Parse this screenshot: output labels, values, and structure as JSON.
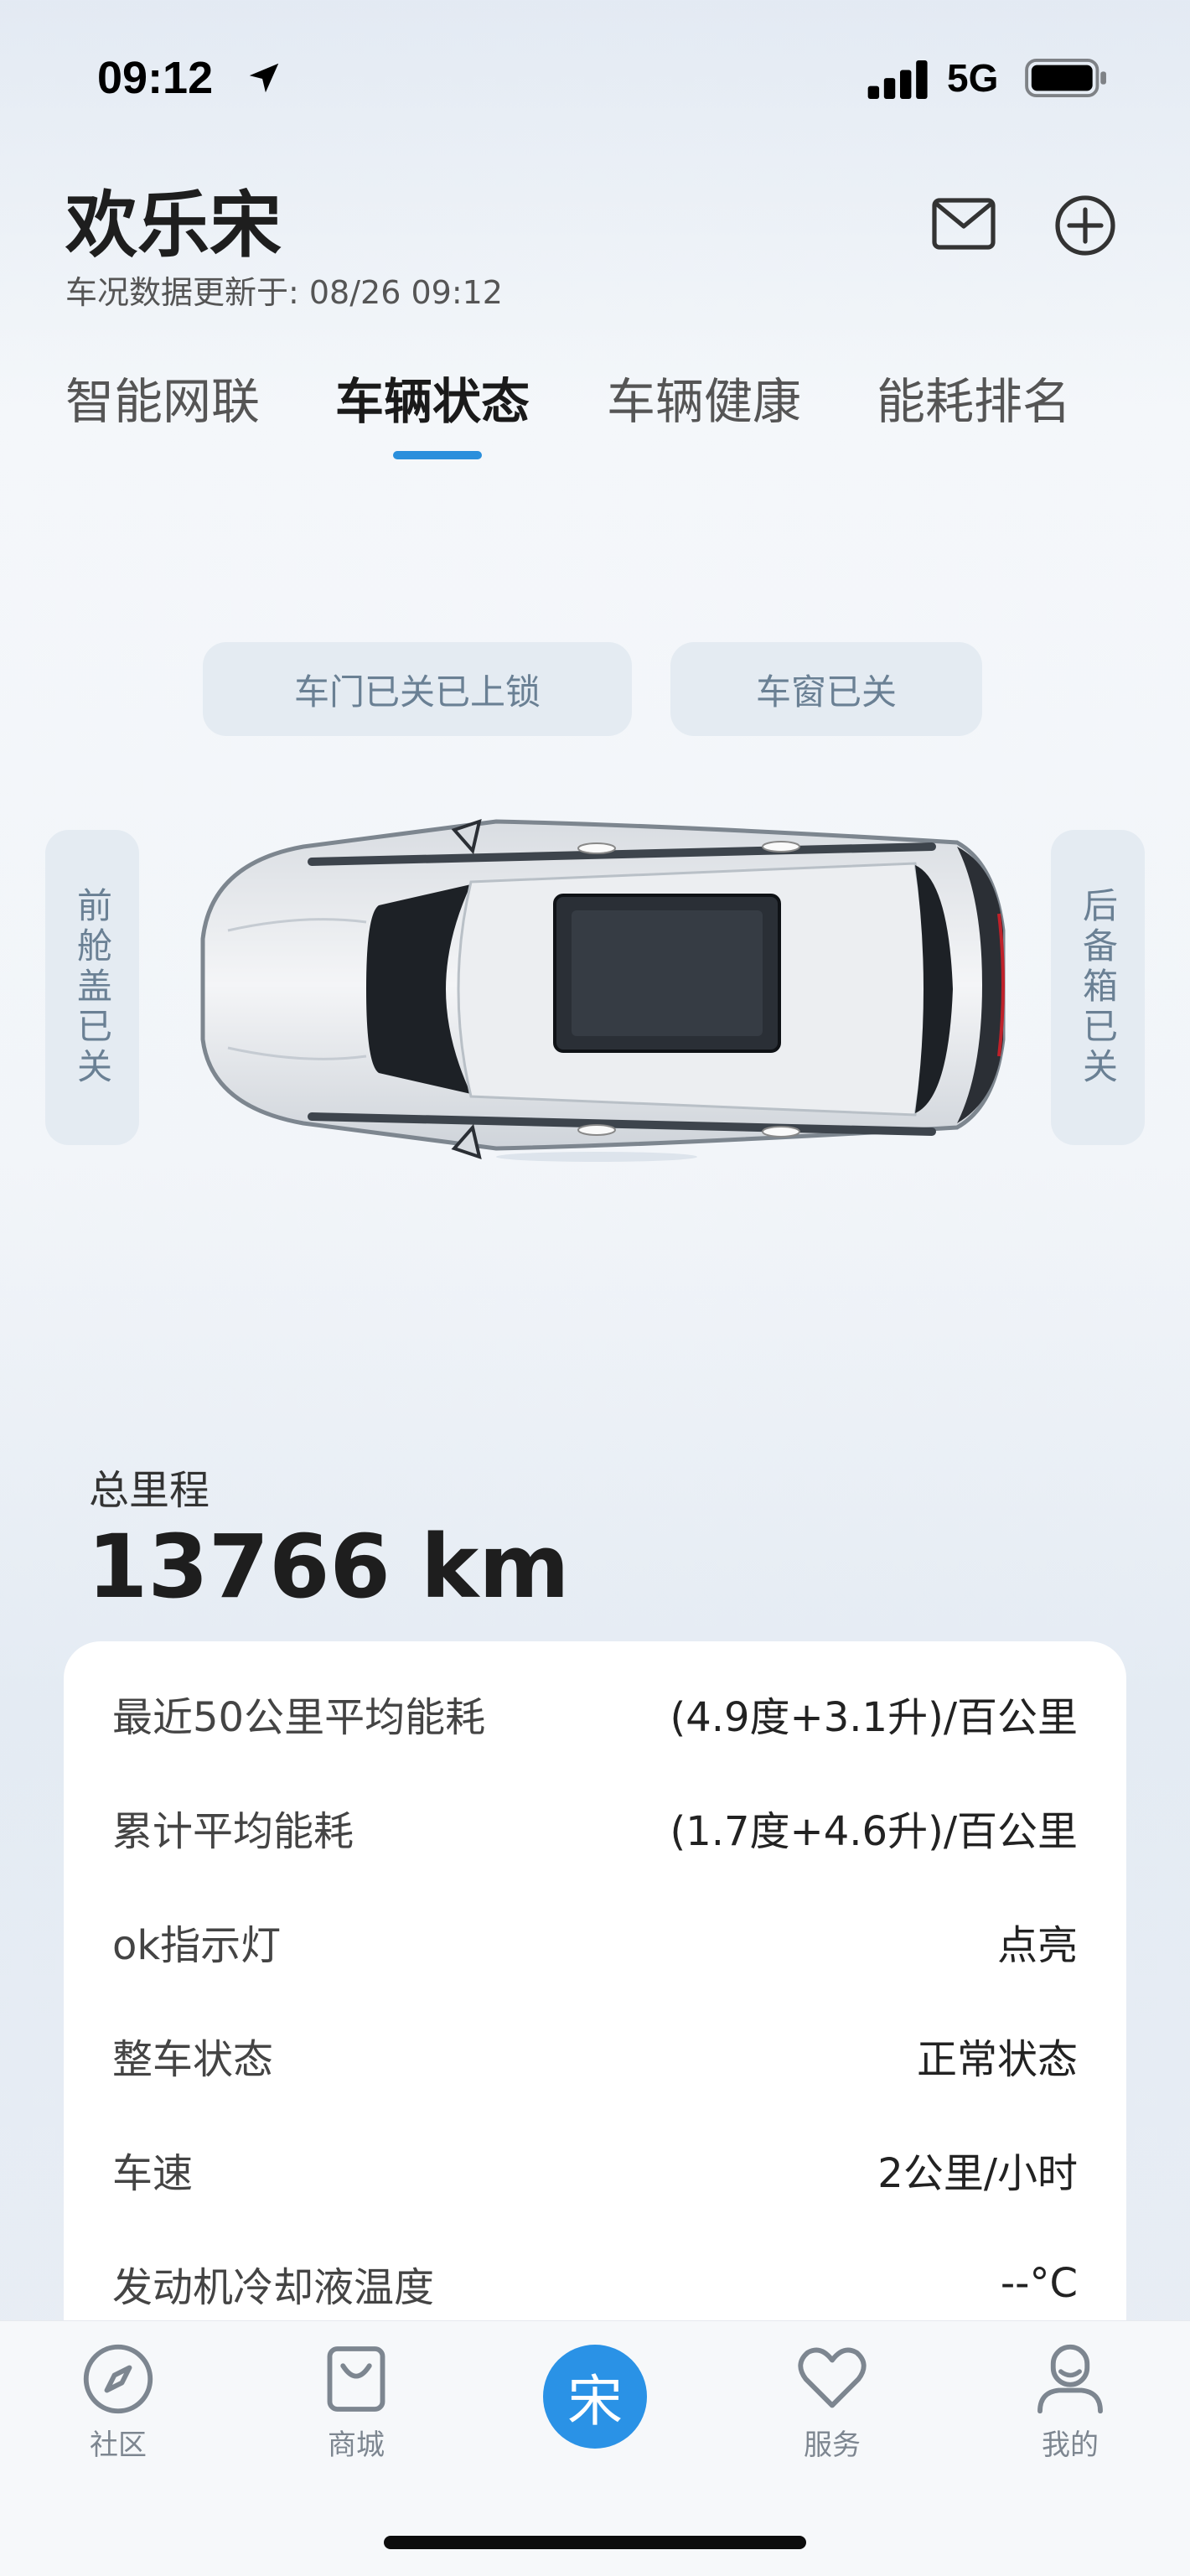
{
  "status_bar": {
    "time": "09:12",
    "network": "5G"
  },
  "header": {
    "title": "欢乐宋",
    "update_time": "车况数据更新于: 08/26 09:12"
  },
  "tabs": [
    {
      "label": "智能网联"
    },
    {
      "label": "车辆状态",
      "active": true
    },
    {
      "label": "车辆健康"
    },
    {
      "label": "能耗排名"
    }
  ],
  "vehicle": {
    "door_status": "车门已关已上锁",
    "window_status": "车窗已关",
    "hood_status": "前舱盖已关",
    "trunk_status": "后备箱已关"
  },
  "mileage": {
    "label": "总里程",
    "value": "13766 km"
  },
  "stats": [
    {
      "label": "最近50公里平均能耗",
      "value": "(4.9度+3.1升)/百公里"
    },
    {
      "label": "累计平均能耗",
      "value": "(1.7度+4.6升)/百公里"
    },
    {
      "label": "ok指示灯",
      "value": "点亮"
    },
    {
      "label": "整车状态",
      "value": "正常状态"
    },
    {
      "label": "车速",
      "value": "2公里/小时"
    },
    {
      "label": "发动机冷却液温度",
      "value": "--°C"
    }
  ],
  "bottom_nav": {
    "items": [
      {
        "label": "社区",
        "icon": "compass-icon"
      },
      {
        "label": "商城",
        "icon": "shopping-bag-icon"
      },
      {
        "label": "宋",
        "icon": "song-logo"
      },
      {
        "label": "服务",
        "icon": "heart-icon"
      },
      {
        "label": "我的",
        "icon": "profile-icon"
      }
    ]
  },
  "colors": {
    "accent": "#2a8fdc",
    "pill_bg": "#e4ebf2",
    "pill_text": "#6a8094"
  }
}
